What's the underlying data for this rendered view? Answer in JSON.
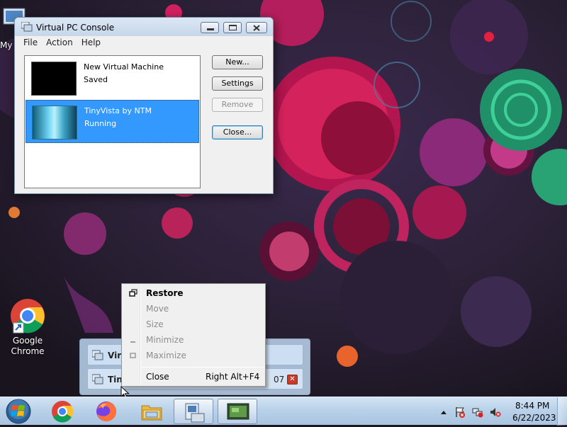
{
  "desktop": {
    "icons": [
      {
        "label": "My",
        "icon": "computer-icon"
      },
      {
        "label": "Google Chrome",
        "icon": "chrome-icon"
      }
    ]
  },
  "window": {
    "title": "Virtual PC Console",
    "menu": [
      "File",
      "Action",
      "Help"
    ],
    "vms": [
      {
        "name": "New Virtual Machine",
        "status": "Saved",
        "selected": false
      },
      {
        "name": "TinyVista by NTM",
        "status": "Running",
        "selected": true
      }
    ],
    "buttons": {
      "new": "New...",
      "settings": "Settings",
      "remove": "Remove",
      "close": "Close..."
    }
  },
  "preview": {
    "rows": [
      {
        "label": "Virt",
        "icon": "virtual-pc-icon"
      },
      {
        "label": "Tiny",
        "icon": "virtual-pc-icon"
      }
    ],
    "time_fragment": "07",
    "close_glyph": "✕"
  },
  "context_menu": {
    "items": [
      {
        "label": "Restore",
        "shortcut": "",
        "disabled": false,
        "bold": true,
        "icon": "restore-icon"
      },
      {
        "label": "Move",
        "shortcut": "",
        "disabled": true,
        "bold": false,
        "icon": ""
      },
      {
        "label": "Size",
        "shortcut": "",
        "disabled": true,
        "bold": false,
        "icon": ""
      },
      {
        "label": "Minimize",
        "shortcut": "",
        "disabled": true,
        "bold": false,
        "icon": "minimize-icon"
      },
      {
        "label": "Maximize",
        "shortcut": "",
        "disabled": true,
        "bold": false,
        "icon": "maximize-icon"
      },
      {
        "label": "Close",
        "shortcut": "Right Alt+F4",
        "disabled": false,
        "bold": false,
        "icon": ""
      }
    ]
  },
  "taskbar": {
    "start": "windows-start-icon",
    "pinned": [
      "chrome-icon",
      "firefox-icon",
      "file-explorer-icon",
      "virtual-pc-console-icon",
      "virtual-machine-window-icon"
    ],
    "tray": [
      "show-hidden-icons",
      "action-center-icon",
      "network-icon",
      "volume-muted-icon"
    ],
    "clock_time": "8:44 PM",
    "clock_date": "6/22/2023"
  },
  "colors": {
    "selection": "#3399ff",
    "taskbar": "#bad2e9",
    "close_red": "#c73b2b"
  }
}
